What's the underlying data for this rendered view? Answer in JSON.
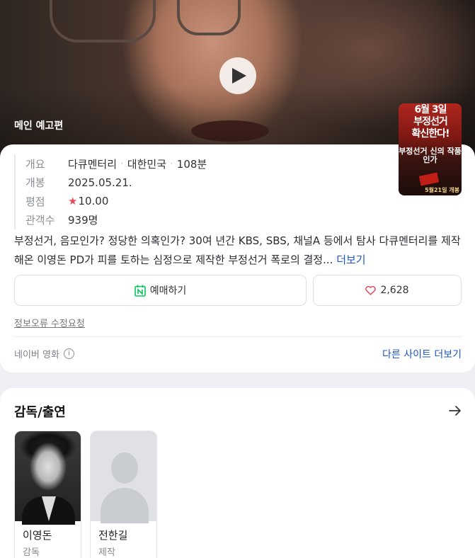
{
  "hero": {
    "trailer_label": "메인 예고편"
  },
  "poster": {
    "line1": "6월 3일",
    "line2": "부정선거",
    "line3": "확신한다!",
    "small": "",
    "mid": "부정선거 신의 작품인가",
    "bottom": "5월21일 개봉"
  },
  "info": {
    "rows": [
      {
        "key": "개요",
        "value_parts": [
          "다큐멘터리",
          "대한민국",
          "108분"
        ]
      },
      {
        "key": "개봉",
        "value": "2025.05.21."
      },
      {
        "key": "평점",
        "star": "★",
        "value": "10.00"
      },
      {
        "key": "관객수",
        "value": "939명"
      }
    ],
    "synopsis": "부정선거, 음모인가? 정당한 의혹인가? 30여 년간 KBS, SBS, 채널A 등에서 탐사 다큐멘터리를 제작해온 이영돈 PD가 피를 토하는 심정으로 제작한 부정선거 폭로의 결정...",
    "more_label": "더보기",
    "book_label": "예매하기",
    "like_count": "2,628",
    "report_label": "정보오류 수정요청",
    "source_label": "네이버 영화",
    "other_sites_label": "다른 사이트 더보기"
  },
  "cast": {
    "title": "감독/출연",
    "people": [
      {
        "name": "이영돈",
        "role": "감독"
      },
      {
        "name": "전한길",
        "role": "제작"
      }
    ]
  },
  "colors": {
    "accent_link": "#1e56c8",
    "star": "#e24d5a",
    "booking_icon": "#03c75a"
  }
}
